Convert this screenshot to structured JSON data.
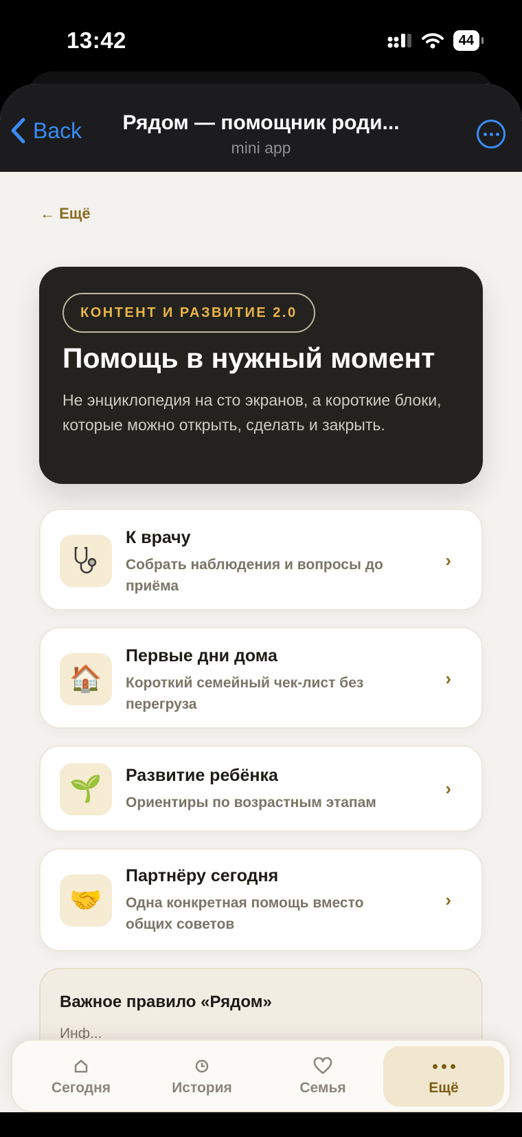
{
  "status_bar": {
    "time": "13:42",
    "battery": "44"
  },
  "nav": {
    "back_label": "Back",
    "title": "Рядом — помощник роди...",
    "subtitle": "mini app"
  },
  "page": {
    "back_link": "← Ещё",
    "hero": {
      "badge": "КОНТЕНТ И РАЗВИТИЕ 2.0",
      "title": "Помощь в нужный момент",
      "text": "Не энциклопедия на сто экранов, а короткие блоки, которые можно открыть, сделать и закрыть."
    },
    "cards": [
      {
        "icon": "stethoscope-icon",
        "title": "К врачу",
        "desc": "Собрать наблюдения и вопросы до приёма"
      },
      {
        "icon": "house-icon",
        "glyph": "🏠",
        "title": "Первые дни дома",
        "desc": "Короткий семейный чек-лист без перегруза"
      },
      {
        "icon": "seedling-icon",
        "glyph": "🌱",
        "title": "Развитие ребёнка",
        "desc": "Ориентиры по возрастным этапам"
      },
      {
        "icon": "handshake-icon",
        "glyph": "🤝",
        "title": "Партнёру сегодня",
        "desc": "Одна конкретная помощь вместо общих советов"
      }
    ],
    "rule": {
      "title": "Важное правило «Рядом»",
      "text": "Инф..."
    }
  },
  "tabbar": {
    "tabs": [
      {
        "label": "Сегодня",
        "icon": "home-icon"
      },
      {
        "label": "История",
        "icon": "clock-icon"
      },
      {
        "label": "Семья",
        "icon": "heart-icon"
      },
      {
        "label": "Ещё",
        "icon": "more-dots-icon",
        "active": true
      }
    ]
  },
  "colors": {
    "accent_blue": "#3a8cf5",
    "gold": "#8a6d1e",
    "hero_bg": "#23221e",
    "badge_text": "#e9b54a",
    "page_bg": "#f3f2ef"
  }
}
